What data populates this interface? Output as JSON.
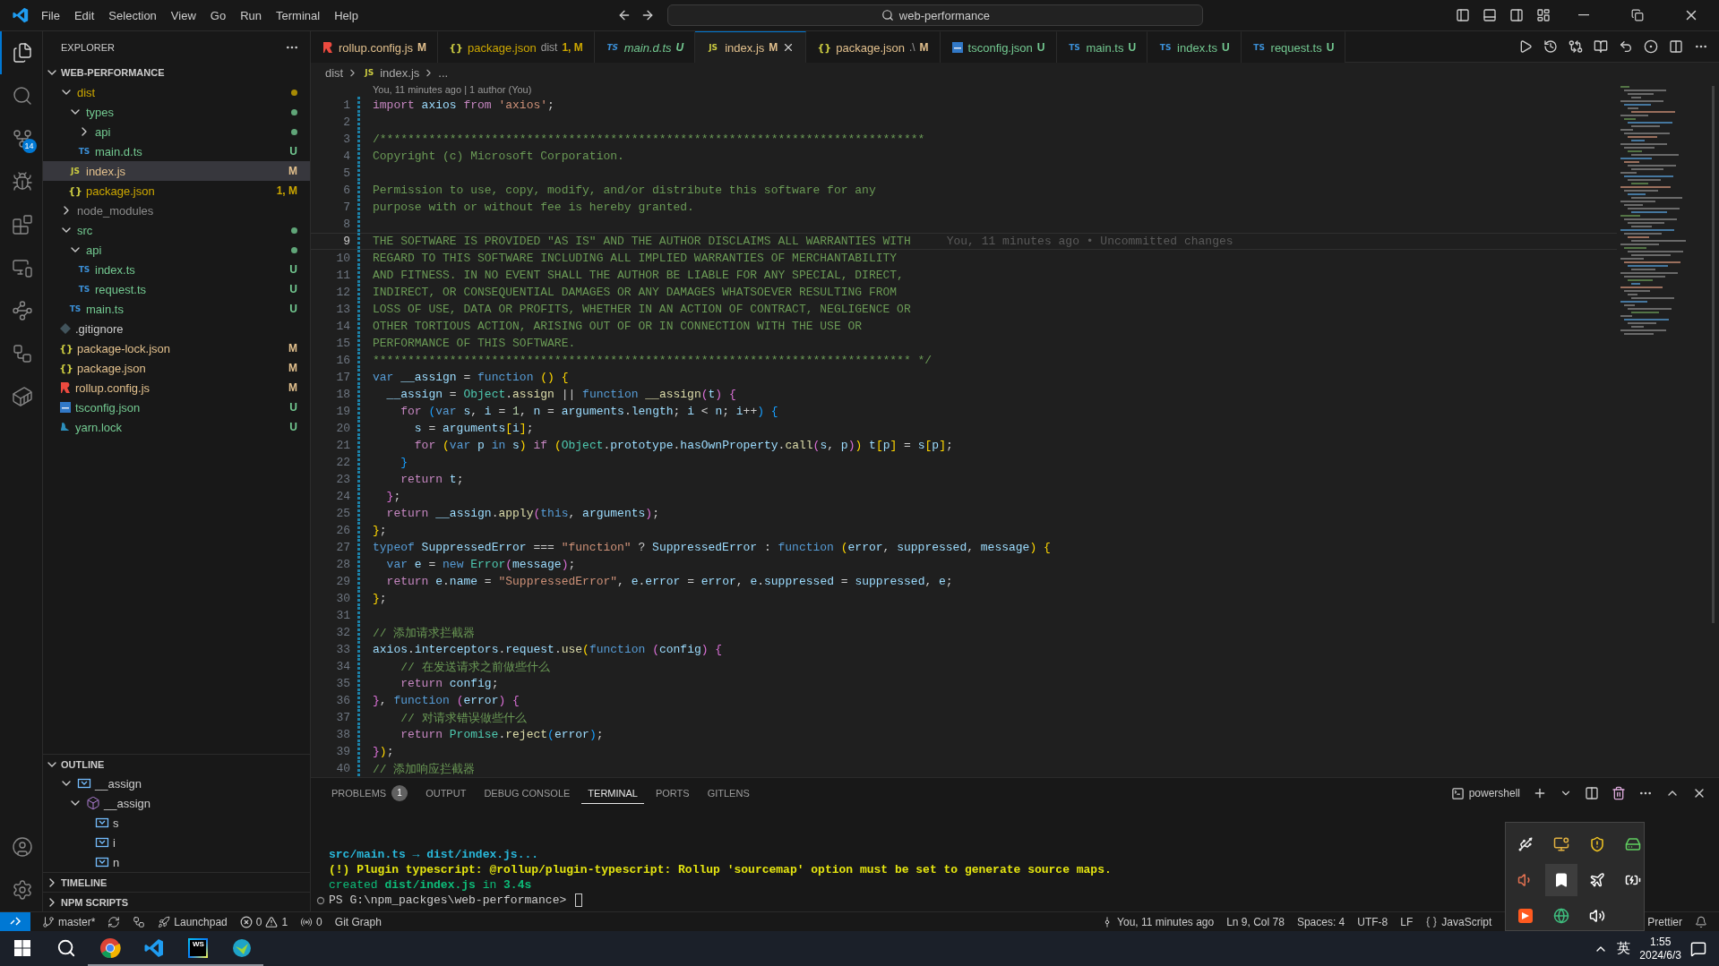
{
  "title_bar": {
    "menus": [
      "File",
      "Edit",
      "Selection",
      "View",
      "Go",
      "Run",
      "Terminal",
      "Help"
    ],
    "search": {
      "value": "web-performance"
    }
  },
  "activity_bar": {
    "items": [
      {
        "kind": "explorer",
        "selected": true
      },
      {
        "kind": "search",
        "selected": false
      },
      {
        "kind": "source_control",
        "selected": false,
        "badge": "14"
      },
      {
        "kind": "debug",
        "selected": false
      },
      {
        "kind": "extensions",
        "selected": false
      },
      {
        "kind": "remote",
        "selected": false
      },
      {
        "kind": "graph",
        "selected": false
      },
      {
        "kind": "gitlens",
        "selected": false
      },
      {
        "kind": "docker",
        "selected": false
      }
    ],
    "bottom": [
      {
        "kind": "account"
      },
      {
        "kind": "settings"
      }
    ]
  },
  "explorer": {
    "title": "EXPLORER",
    "root": {
      "label": "WEB-PERFORMANCE",
      "expanded": true
    },
    "tree": [
      {
        "label": "dist",
        "kind": "folder",
        "expanded": true,
        "color": "#cca700",
        "dot": true,
        "selected": false,
        "children": [
          {
            "label": "types",
            "kind": "folder",
            "expanded": true,
            "color": "#73c991",
            "dot": true,
            "selected": false,
            "children": [
              {
                "label": "api",
                "kind": "folder",
                "expanded": false,
                "color": "#73c991",
                "dot": true,
                "selected": false
              },
              {
                "label": "main.d.ts",
                "kind": "ts",
                "glyph": "TS",
                "color": "#73c991",
                "badge": "U",
                "selected": false
              }
            ]
          },
          {
            "label": "index.js",
            "kind": "js",
            "glyph": "JS",
            "color": "#e2c08d",
            "badge": "M",
            "selected": true
          },
          {
            "label": "package.json",
            "kind": "json",
            "glyph": "{}",
            "color": "#cca700",
            "badge": "1, M",
            "selected": false
          }
        ]
      },
      {
        "label": "node_modules",
        "kind": "folder",
        "expanded": false,
        "color": "#8c8c8c",
        "dot": false,
        "selected": false
      },
      {
        "label": "src",
        "kind": "folder",
        "expanded": true,
        "color": "#73c991",
        "dot": true,
        "selected": false,
        "children": [
          {
            "label": "api",
            "kind": "folder",
            "expanded": true,
            "color": "#73c991",
            "dot": true,
            "selected": false,
            "children": [
              {
                "label": "index.ts",
                "kind": "ts",
                "glyph": "TS",
                "color": "#73c991",
                "badge": "U",
                "selected": false
              },
              {
                "label": "request.ts",
                "kind": "ts",
                "glyph": "TS",
                "color": "#73c991",
                "badge": "U",
                "selected": false
              }
            ]
          },
          {
            "label": "main.ts",
            "kind": "ts",
            "glyph": "TS",
            "color": "#73c991",
            "badge": "U",
            "selected": false
          }
        ]
      },
      {
        "label": ".gitignore",
        "kind": "git",
        "color": "#cccccc",
        "selected": false
      },
      {
        "label": "package-lock.json",
        "kind": "json",
        "glyph": "{}",
        "color": "#e2c08d",
        "badge": "M",
        "selected": false
      },
      {
        "label": "package.json",
        "kind": "json",
        "glyph": "{}",
        "color": "#e2c08d",
        "badge": "M",
        "selected": false
      },
      {
        "label": "rollup.config.js",
        "kind": "rollup",
        "color": "#e2c08d",
        "badge": "M",
        "selected": false
      },
      {
        "label": "tsconfig.json",
        "kind": "tsconfig",
        "color": "#73c991",
        "badge": "U",
        "selected": false
      },
      {
        "label": "yarn.lock",
        "kind": "yarn",
        "color": "#73c991",
        "badge": "U",
        "selected": false
      }
    ]
  },
  "outline": {
    "title": "OUTLINE",
    "expanded": true,
    "items": [
      {
        "label": "__assign",
        "kind": "variable",
        "expanded": true,
        "children": [
          {
            "label": "__assign",
            "kind": "function",
            "expanded": true,
            "children": [
              {
                "label": "s",
                "kind": "variable"
              },
              {
                "label": "i",
                "kind": "variable"
              },
              {
                "label": "n",
                "kind": "variable"
              }
            ]
          }
        ]
      }
    ]
  },
  "sections": [
    {
      "title": "TIMELINE",
      "expanded": false
    },
    {
      "title": "NPM SCRIPTS",
      "expanded": false
    }
  ],
  "tabs": [
    {
      "label": "rollup.config.js",
      "kind": "rollup",
      "color": "#e2c08d",
      "badge": "M",
      "selected": false,
      "preview": false
    },
    {
      "label": "package.json",
      "kind": "json",
      "glyph": "{}",
      "description": "dist",
      "color": "#cca700",
      "badge": "1, M",
      "selected": false,
      "preview": false
    },
    {
      "label": "main.d.ts",
      "kind": "ts",
      "glyph": "TS",
      "color": "#73c991",
      "badge": "U",
      "selected": false,
      "preview": true
    },
    {
      "label": "index.js",
      "kind": "js",
      "glyph": "JS",
      "color": "#e2c08d",
      "badge": "M",
      "selected": true,
      "preview": false
    },
    {
      "label": "package.json",
      "kind": "json",
      "glyph": "{}",
      "description": ".\\",
      "color": "#e2c08d",
      "badge": "M",
      "selected": false,
      "preview": false
    },
    {
      "label": "tsconfig.json",
      "kind": "tsconfig",
      "color": "#73c991",
      "badge": "U",
      "selected": false,
      "preview": false
    },
    {
      "label": "main.ts",
      "kind": "ts",
      "glyph": "TS",
      "color": "#73c991",
      "badge": "U",
      "selected": false,
      "preview": false
    },
    {
      "label": "index.ts",
      "kind": "ts",
      "glyph": "TS",
      "color": "#73c991",
      "badge": "U",
      "selected": false,
      "preview": false
    },
    {
      "label": "request.ts",
      "kind": "ts",
      "glyph": "TS",
      "color": "#73c991",
      "badge": "U",
      "selected": false,
      "preview": false
    }
  ],
  "breadcrumb": [
    {
      "label": "dist"
    },
    {
      "label": "index.js",
      "glyph": "JS"
    },
    {
      "label": "..."
    }
  ],
  "editor": {
    "codelens": "You, 11 minutes ago | 1 author (You)",
    "lines": [
      {
        "number": "1",
        "changed": true,
        "tokens": [
          {
            "kind": "ctl",
            "text": "import"
          },
          {
            "kind": "var",
            "text": " axios "
          },
          {
            "kind": "ctl",
            "text": "from"
          },
          {
            "kind": "str",
            "text": " 'axios'"
          },
          {
            "kind": "pun",
            "text": ";"
          }
        ]
      },
      {
        "number": "2",
        "changed": true
      },
      {
        "number": "3",
        "changed": true,
        "tokens": [
          {
            "kind": "com",
            "text": "/******************************************************************************"
          }
        ]
      },
      {
        "number": "4",
        "changed": true,
        "tokens": [
          {
            "kind": "com",
            "text": "Copyright (c) Microsoft Corporation."
          }
        ]
      },
      {
        "number": "5",
        "changed": true
      },
      {
        "number": "6",
        "changed": true,
        "tokens": [
          {
            "kind": "com",
            "text": "Permission to use, copy, modify, and/or distribute this software for any"
          }
        ]
      },
      {
        "number": "7",
        "changed": true,
        "tokens": [
          {
            "kind": "com",
            "text": "purpose with or without fee is hereby granted."
          }
        ]
      },
      {
        "number": "8",
        "changed": true
      },
      {
        "number": "9",
        "changed": true,
        "current": true,
        "blame": "You, 11 minutes ago • Uncommitted changes",
        "tokens": [
          {
            "kind": "com",
            "text": "THE SOFTWARE IS PROVIDED \"AS IS\" AND THE AUTHOR DISCLAIMS ALL WARRANTIES WITH"
          }
        ]
      },
      {
        "number": "10",
        "changed": true,
        "tokens": [
          {
            "kind": "com",
            "text": "REGARD TO THIS SOFTWARE INCLUDING ALL IMPLIED WARRANTIES OF MERCHANTABILITY"
          }
        ]
      },
      {
        "number": "11",
        "changed": true,
        "tokens": [
          {
            "kind": "com",
            "text": "AND FITNESS. IN NO EVENT SHALL THE AUTHOR BE LIABLE FOR ANY SPECIAL, DIRECT,"
          }
        ]
      },
      {
        "number": "12",
        "changed": true,
        "tokens": [
          {
            "kind": "com",
            "text": "INDIRECT, OR CONSEQUENTIAL DAMAGES OR ANY DAMAGES WHATSOEVER RESULTING FROM"
          }
        ]
      },
      {
        "number": "13",
        "changed": true,
        "tokens": [
          {
            "kind": "com",
            "text": "LOSS OF USE, DATA OR PROFITS, WHETHER IN AN ACTION OF CONTRACT, NEGLIGENCE OR"
          }
        ]
      },
      {
        "number": "14",
        "changed": true,
        "tokens": [
          {
            "kind": "com",
            "text": "OTHER TORTIOUS ACTION, ARISING OUT OF OR IN CONNECTION WITH THE USE OR"
          }
        ]
      },
      {
        "number": "15",
        "changed": true,
        "tokens": [
          {
            "kind": "com",
            "text": "PERFORMANCE OF THIS SOFTWARE."
          }
        ]
      },
      {
        "number": "16",
        "changed": true,
        "tokens": [
          {
            "kind": "com",
            "text": "***************************************************************************** */"
          }
        ]
      },
      {
        "number": "17",
        "changed": true,
        "tokens": [
          {
            "kind": "kw",
            "text": "var"
          },
          {
            "kind": "var",
            "text": " __assign"
          },
          {
            "kind": "pun",
            "text": " = "
          },
          {
            "kind": "kw",
            "text": "function"
          },
          {
            "kind": "b1",
            "text": " ()"
          },
          {
            "kind": "b1",
            "text": " {"
          }
        ]
      },
      {
        "number": "18",
        "changed": true,
        "tokens": [
          {
            "kind": "var",
            "text": "  __assign"
          },
          {
            "kind": "pun",
            "text": " = "
          },
          {
            "kind": "cls",
            "text": "Object"
          },
          {
            "kind": "pun",
            "text": "."
          },
          {
            "kind": "fn",
            "text": "assign"
          },
          {
            "kind": "pun",
            "text": " || "
          },
          {
            "kind": "kw",
            "text": "function"
          },
          {
            "kind": "fn",
            "text": " __assign"
          },
          {
            "kind": "b2",
            "text": "("
          },
          {
            "kind": "var",
            "text": "t"
          },
          {
            "kind": "b2",
            "text": ")"
          },
          {
            "kind": "b2",
            "text": " {"
          }
        ]
      },
      {
        "number": "19",
        "changed": true,
        "tokens": [
          {
            "kind": "ctl",
            "text": "    for"
          },
          {
            "kind": "b3",
            "text": " ("
          },
          {
            "kind": "kw",
            "text": "var"
          },
          {
            "kind": "var",
            "text": " s"
          },
          {
            "kind": "pun",
            "text": ", "
          },
          {
            "kind": "var",
            "text": "i"
          },
          {
            "kind": "pun",
            "text": " = "
          },
          {
            "kind": "num",
            "text": "1"
          },
          {
            "kind": "pun",
            "text": ", "
          },
          {
            "kind": "var",
            "text": "n"
          },
          {
            "kind": "pun",
            "text": " = "
          },
          {
            "kind": "var",
            "text": "arguments"
          },
          {
            "kind": "pun",
            "text": "."
          },
          {
            "kind": "var",
            "text": "length"
          },
          {
            "kind": "pun",
            "text": "; "
          },
          {
            "kind": "var",
            "text": "i"
          },
          {
            "kind": "pun",
            "text": " < "
          },
          {
            "kind": "var",
            "text": "n"
          },
          {
            "kind": "pun",
            "text": "; "
          },
          {
            "kind": "var",
            "text": "i"
          },
          {
            "kind": "pun",
            "text": "++"
          },
          {
            "kind": "b3",
            "text": ")"
          },
          {
            "kind": "b3",
            "text": " {"
          }
        ]
      },
      {
        "number": "20",
        "changed": true,
        "tokens": [
          {
            "kind": "var",
            "text": "      s"
          },
          {
            "kind": "pun",
            "text": " = "
          },
          {
            "kind": "var",
            "text": "arguments"
          },
          {
            "kind": "b1",
            "text": "["
          },
          {
            "kind": "var",
            "text": "i"
          },
          {
            "kind": "b1",
            "text": "]"
          },
          {
            "kind": "pun",
            "text": ";"
          }
        ]
      },
      {
        "number": "21",
        "changed": true,
        "tokens": [
          {
            "kind": "ctl",
            "text": "      for"
          },
          {
            "kind": "b1",
            "text": " ("
          },
          {
            "kind": "kw",
            "text": "var"
          },
          {
            "kind": "var",
            "text": " p"
          },
          {
            "kind": "kw",
            "text": " in"
          },
          {
            "kind": "var",
            "text": " s"
          },
          {
            "kind": "b1",
            "text": ")"
          },
          {
            "kind": "ctl",
            "text": " if"
          },
          {
            "kind": "b1",
            "text": " ("
          },
          {
            "kind": "cls",
            "text": "Object"
          },
          {
            "kind": "pun",
            "text": "."
          },
          {
            "kind": "var",
            "text": "prototype"
          },
          {
            "kind": "pun",
            "text": "."
          },
          {
            "kind": "var",
            "text": "hasOwnProperty"
          },
          {
            "kind": "pun",
            "text": "."
          },
          {
            "kind": "fn",
            "text": "call"
          },
          {
            "kind": "b2",
            "text": "("
          },
          {
            "kind": "var",
            "text": "s"
          },
          {
            "kind": "pun",
            "text": ", "
          },
          {
            "kind": "var",
            "text": "p"
          },
          {
            "kind": "b2",
            "text": ")"
          },
          {
            "kind": "b1",
            "text": ")"
          },
          {
            "kind": "var",
            "text": " t"
          },
          {
            "kind": "b1",
            "text": "["
          },
          {
            "kind": "var",
            "text": "p"
          },
          {
            "kind": "b1",
            "text": "]"
          },
          {
            "kind": "pun",
            "text": " = "
          },
          {
            "kind": "var",
            "text": "s"
          },
          {
            "kind": "b1",
            "text": "["
          },
          {
            "kind": "var",
            "text": "p"
          },
          {
            "kind": "b1",
            "text": "]"
          },
          {
            "kind": "pun",
            "text": ";"
          }
        ]
      },
      {
        "number": "22",
        "changed": true,
        "tokens": [
          {
            "kind": "b3",
            "text": "    }"
          }
        ]
      },
      {
        "number": "23",
        "changed": true,
        "tokens": [
          {
            "kind": "ctl",
            "text": "    return"
          },
          {
            "kind": "var",
            "text": " t"
          },
          {
            "kind": "pun",
            "text": ";"
          }
        ]
      },
      {
        "number": "24",
        "changed": true,
        "tokens": [
          {
            "kind": "b2",
            "text": "  }"
          },
          {
            "kind": "pun",
            "text": ";"
          }
        ]
      },
      {
        "number": "25",
        "changed": true,
        "tokens": [
          {
            "kind": "ctl",
            "text": "  return"
          },
          {
            "kind": "var",
            "text": " __assign"
          },
          {
            "kind": "pun",
            "text": "."
          },
          {
            "kind": "fn",
            "text": "apply"
          },
          {
            "kind": "b2",
            "text": "("
          },
          {
            "kind": "kw",
            "text": "this"
          },
          {
            "kind": "pun",
            "text": ", "
          },
          {
            "kind": "var",
            "text": "arguments"
          },
          {
            "kind": "b2",
            "text": ")"
          },
          {
            "kind": "pun",
            "text": ";"
          }
        ]
      },
      {
        "number": "26",
        "changed": true,
        "tokens": [
          {
            "kind": "b1",
            "text": "}"
          },
          {
            "kind": "pun",
            "text": ";"
          }
        ]
      },
      {
        "number": "27",
        "changed": true,
        "tokens": [
          {
            "kind": "kw",
            "text": "typeof"
          },
          {
            "kind": "var",
            "text": " SuppressedError"
          },
          {
            "kind": "pun",
            "text": " === "
          },
          {
            "kind": "str",
            "text": "\"function\""
          },
          {
            "kind": "pun",
            "text": " ? "
          },
          {
            "kind": "var",
            "text": "SuppressedError"
          },
          {
            "kind": "pun",
            "text": " : "
          },
          {
            "kind": "kw",
            "text": "function"
          },
          {
            "kind": "b1",
            "text": " ("
          },
          {
            "kind": "var",
            "text": "error"
          },
          {
            "kind": "pun",
            "text": ", "
          },
          {
            "kind": "var",
            "text": "suppressed"
          },
          {
            "kind": "pun",
            "text": ", "
          },
          {
            "kind": "var",
            "text": "message"
          },
          {
            "kind": "b1",
            "text": ")"
          },
          {
            "kind": "b1",
            "text": " {"
          }
        ]
      },
      {
        "number": "28",
        "changed": true,
        "tokens": [
          {
            "kind": "kw",
            "text": "  var"
          },
          {
            "kind": "var",
            "text": " e"
          },
          {
            "kind": "pun",
            "text": " = "
          },
          {
            "kind": "kw",
            "text": "new"
          },
          {
            "kind": "cls",
            "text": " Error"
          },
          {
            "kind": "b2",
            "text": "("
          },
          {
            "kind": "var",
            "text": "message"
          },
          {
            "kind": "b2",
            "text": ")"
          },
          {
            "kind": "pun",
            "text": ";"
          }
        ]
      },
      {
        "number": "29",
        "changed": true,
        "tokens": [
          {
            "kind": "ctl",
            "text": "  return"
          },
          {
            "kind": "var",
            "text": " e"
          },
          {
            "kind": "pun",
            "text": "."
          },
          {
            "kind": "var",
            "text": "name"
          },
          {
            "kind": "pun",
            "text": " = "
          },
          {
            "kind": "str",
            "text": "\"SuppressedError\""
          },
          {
            "kind": "pun",
            "text": ", "
          },
          {
            "kind": "var",
            "text": "e"
          },
          {
            "kind": "pun",
            "text": "."
          },
          {
            "kind": "var",
            "text": "error"
          },
          {
            "kind": "pun",
            "text": " = "
          },
          {
            "kind": "var",
            "text": "error"
          },
          {
            "kind": "pun",
            "text": ", "
          },
          {
            "kind": "var",
            "text": "e"
          },
          {
            "kind": "pun",
            "text": "."
          },
          {
            "kind": "var",
            "text": "suppressed"
          },
          {
            "kind": "pun",
            "text": " = "
          },
          {
            "kind": "var",
            "text": "suppressed"
          },
          {
            "kind": "pun",
            "text": ", "
          },
          {
            "kind": "var",
            "text": "e"
          },
          {
            "kind": "pun",
            "text": ";"
          }
        ]
      },
      {
        "number": "30",
        "changed": true,
        "tokens": [
          {
            "kind": "b1",
            "text": "}"
          },
          {
            "kind": "pun",
            "text": ";"
          }
        ]
      },
      {
        "number": "31",
        "changed": true
      },
      {
        "number": "32",
        "changed": true,
        "tokens": [
          {
            "kind": "com",
            "text": "// 添加请求拦截器"
          }
        ]
      },
      {
        "number": "33",
        "changed": true,
        "tokens": [
          {
            "kind": "var",
            "text": "axios"
          },
          {
            "kind": "pun",
            "text": "."
          },
          {
            "kind": "var",
            "text": "interceptors"
          },
          {
            "kind": "pun",
            "text": "."
          },
          {
            "kind": "var",
            "text": "request"
          },
          {
            "kind": "pun",
            "text": "."
          },
          {
            "kind": "fn",
            "text": "use"
          },
          {
            "kind": "b1",
            "text": "("
          },
          {
            "kind": "kw",
            "text": "function"
          },
          {
            "kind": "b2",
            "text": " ("
          },
          {
            "kind": "var",
            "text": "config"
          },
          {
            "kind": "b2",
            "text": ")"
          },
          {
            "kind": "b2",
            "text": " {"
          }
        ]
      },
      {
        "number": "34",
        "changed": true,
        "tokens": [
          {
            "kind": "com",
            "text": "    // 在发送请求之前做些什么"
          }
        ]
      },
      {
        "number": "35",
        "changed": true,
        "tokens": [
          {
            "kind": "ctl",
            "text": "    return"
          },
          {
            "kind": "var",
            "text": " config"
          },
          {
            "kind": "pun",
            "text": ";"
          }
        ]
      },
      {
        "number": "36",
        "changed": true,
        "tokens": [
          {
            "kind": "b2",
            "text": "}"
          },
          {
            "kind": "pun",
            "text": ", "
          },
          {
            "kind": "kw",
            "text": "function"
          },
          {
            "kind": "b2",
            "text": " ("
          },
          {
            "kind": "var",
            "text": "error"
          },
          {
            "kind": "b2",
            "text": ")"
          },
          {
            "kind": "b2",
            "text": " {"
          }
        ]
      },
      {
        "number": "37",
        "changed": true,
        "tokens": [
          {
            "kind": "com",
            "text": "    // 对请求错误做些什么"
          }
        ]
      },
      {
        "number": "38",
        "changed": true,
        "tokens": [
          {
            "kind": "ctl",
            "text": "    return"
          },
          {
            "kind": "cls",
            "text": " Promise"
          },
          {
            "kind": "pun",
            "text": "."
          },
          {
            "kind": "fn",
            "text": "reject"
          },
          {
            "kind": "b3",
            "text": "("
          },
          {
            "kind": "var",
            "text": "error"
          },
          {
            "kind": "b3",
            "text": ")"
          },
          {
            "kind": "pun",
            "text": ";"
          }
        ]
      },
      {
        "number": "39",
        "changed": true,
        "tokens": [
          {
            "kind": "b2",
            "text": "}"
          },
          {
            "kind": "b1",
            "text": ")"
          },
          {
            "kind": "pun",
            "text": ";"
          }
        ]
      },
      {
        "number": "40",
        "changed": true,
        "tokens": [
          {
            "kind": "com",
            "text": "// 添加响应拦截器"
          }
        ]
      }
    ]
  },
  "panel": {
    "tabs": [
      {
        "label": "PROBLEMS",
        "badge": "1",
        "selected": false
      },
      {
        "label": "OUTPUT",
        "selected": false
      },
      {
        "label": "DEBUG CONSOLE",
        "selected": false
      },
      {
        "label": "TERMINAL",
        "selected": true
      },
      {
        "label": "PORTS",
        "selected": false
      },
      {
        "label": "GITLENS",
        "selected": false
      }
    ],
    "shell": "powershell",
    "terminal": [
      {
        "tokens": [
          {
            "kind": "info",
            "text": "src/main.ts → dist/index.js..."
          }
        ]
      },
      {
        "tokens": [
          {
            "kind": "warn",
            "text": "(!) Plugin typescript: @rollup/plugin-typescript: Rollup 'sourcemap' option must be set to generate source maps."
          }
        ]
      },
      {
        "tokens": [
          {
            "kind": "ok",
            "text": "created "
          },
          {
            "kind": "okb",
            "text": "dist/index.js"
          },
          {
            "kind": "ok",
            "text": " in "
          },
          {
            "kind": "okb",
            "text": "3.4s"
          }
        ]
      },
      {
        "prompt": true,
        "cursor": true,
        "tokens": [
          {
            "kind": "plain",
            "text": "PS G:\\npm_packges\\web-performance>"
          }
        ]
      }
    ]
  },
  "status_bar": {
    "left": [
      {
        "kind": "remote"
      },
      {
        "kind": "branch",
        "text": "master*"
      },
      {
        "kind": "sync"
      },
      {
        "kind": "graph"
      },
      {
        "kind": "launchpad",
        "text": "Launchpad"
      },
      {
        "kind": "problems",
        "errors": "0",
        "warnings": "1"
      },
      {
        "kind": "ports",
        "text": "0"
      },
      {
        "kind": "text",
        "text": "Git Graph"
      }
    ],
    "right": [
      {
        "kind": "blame",
        "text": "You, 11 minutes ago"
      },
      {
        "kind": "text",
        "text": "Ln 9, Col 78"
      },
      {
        "kind": "text",
        "text": "Spaces: 4"
      },
      {
        "kind": "text",
        "text": "UTF-8"
      },
      {
        "kind": "text",
        "text": "LF"
      },
      {
        "kind": "language",
        "text": "JavaScript"
      },
      {
        "kind": "formatter",
        "text": "Prettier"
      },
      {
        "kind": "notifications"
      }
    ]
  },
  "tray_popup": [
    {
      "kind": "usb",
      "selected": false
    },
    {
      "kind": "monitor",
      "selected": false
    },
    {
      "kind": "shield",
      "selected": false
    },
    {
      "kind": "drive",
      "selected": false
    },
    {
      "kind": "speaker",
      "selected": false
    },
    {
      "kind": "bookmark",
      "selected": true
    },
    {
      "kind": "plane",
      "selected": false
    },
    {
      "kind": "battery",
      "selected": false
    },
    {
      "kind": "app",
      "selected": false
    },
    {
      "kind": "globe",
      "selected": false
    },
    {
      "kind": "volume",
      "selected": false
    }
  ],
  "taskbar": {
    "apps": [
      {
        "kind": "start",
        "open": false
      },
      {
        "kind": "search",
        "open": false
      },
      {
        "kind": "browser",
        "open": true
      },
      {
        "kind": "editor",
        "open": true
      },
      {
        "kind": "ide",
        "glyph": "WS",
        "open": true
      },
      {
        "kind": "app",
        "open": true
      }
    ],
    "ime": "英",
    "time": "1:55",
    "date": "2024/6/3"
  }
}
